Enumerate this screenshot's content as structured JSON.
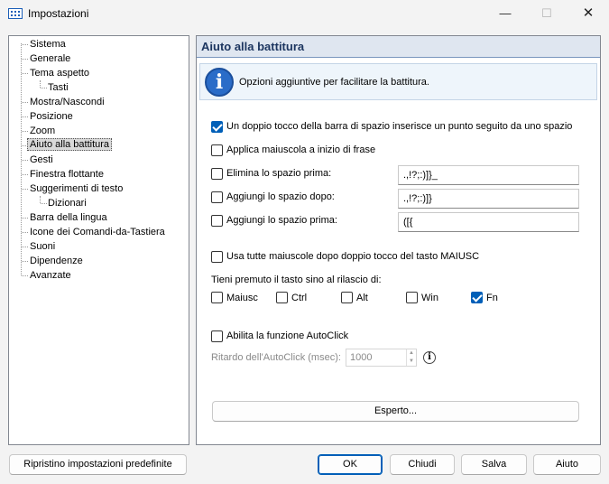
{
  "window": {
    "title": "Impostazioni",
    "minimize_glyph": "—",
    "maximize_glyph": "☐",
    "close_glyph": "✕",
    "icon": "keyboard-icon"
  },
  "tree": {
    "items": [
      {
        "label": "Sistema",
        "level": 0
      },
      {
        "label": "Generale",
        "level": 0
      },
      {
        "label": "Tema aspetto",
        "level": 0
      },
      {
        "label": "Tasti",
        "level": 1
      },
      {
        "label": "Mostra/Nascondi",
        "level": 0
      },
      {
        "label": "Posizione",
        "level": 0
      },
      {
        "label": "Zoom",
        "level": 0
      },
      {
        "label": "Aiuto alla battitura",
        "level": 0,
        "selected": true
      },
      {
        "label": "Gesti",
        "level": 0
      },
      {
        "label": "Finestra flottante",
        "level": 0
      },
      {
        "label": "Suggerimenti di testo",
        "level": 0
      },
      {
        "label": "Dizionari",
        "level": 1
      },
      {
        "label": "Barra della lingua",
        "level": 0
      },
      {
        "label": "Icone dei Comandi-da-Tastiera",
        "level": 0
      },
      {
        "label": "Suoni",
        "level": 0
      },
      {
        "label": "Dipendenze",
        "level": 0
      },
      {
        "label": "Avanzate",
        "level": 0
      }
    ]
  },
  "panel": {
    "title": "Aiuto alla battitura",
    "info_icon_glyph": "i",
    "info_text": "Opzioni aggiuntive per facilitare la battitura.",
    "double_space": {
      "label": "Un doppio tocco della barra di spazio inserisce un punto seguito da uno spazio",
      "checked": true
    },
    "capitalize": {
      "label": "Applica maiuscola a inizio di frase",
      "checked": false
    },
    "remove_space_before": {
      "label": "Elimina lo spazio prima:",
      "checked": false,
      "value": ".,!?;:)]}_"
    },
    "add_space_after": {
      "label": "Aggiungi lo spazio dopo:",
      "checked": false,
      "value": ".,!?;:)]}"
    },
    "add_space_before": {
      "label": "Aggiungi lo spazio prima:",
      "checked": false,
      "value": "([{"
    },
    "caps_lock": {
      "label": "Usa tutte maiuscole dopo doppio tocco del tasto MAIUSC",
      "checked": false
    },
    "hold_key_label": "Tieni premuto il tasto sino al rilascio di:",
    "keys": [
      {
        "label": "Maiusc",
        "checked": false
      },
      {
        "label": "Ctrl",
        "checked": false
      },
      {
        "label": "Alt",
        "checked": false
      },
      {
        "label": "Win",
        "checked": false
      },
      {
        "label": "Fn",
        "checked": true
      }
    ],
    "autoclick": {
      "label": "Abilita la funzione AutoClick",
      "checked": false
    },
    "autoclick_delay_label": "Ritardo dell'AutoClick (msec):",
    "autoclick_delay_value": "1000",
    "spin_up_glyph": "▲",
    "spin_down_glyph": "▼",
    "small_info_glyph": "i",
    "expert_button": "Esperto..."
  },
  "footer": {
    "reset": "Ripristino impostazioni predefinite",
    "ok": "OK",
    "close": "Chiudi",
    "save": "Salva",
    "help": "Aiuto"
  },
  "colors": {
    "accent": "#005fb8",
    "header_bg": "#dfe6f0",
    "header_text": "#1d3660",
    "info_bg": "#eef5fb"
  }
}
